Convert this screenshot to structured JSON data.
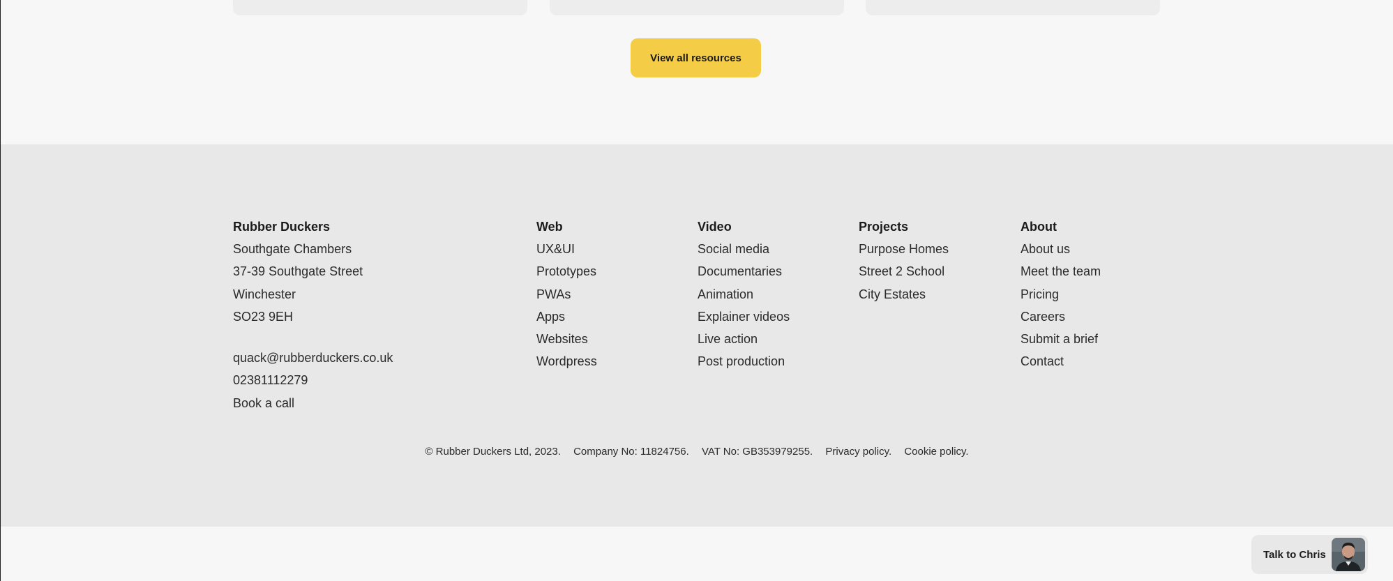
{
  "resources": {
    "view_all_label": "View all resources"
  },
  "footer": {
    "address": {
      "heading": "Rubber Duckers",
      "lines": [
        "Southgate Chambers",
        "37-39 Southgate Street",
        "Winchester",
        "SO23 9EH"
      ],
      "email": "quack@rubberduckers.co.uk",
      "phone": "02381112279",
      "book_call": "Book a call"
    },
    "columns": [
      {
        "heading": "Web",
        "items": [
          "UX&UI",
          "Prototypes",
          "PWAs",
          "Apps",
          "Websites",
          "Wordpress"
        ]
      },
      {
        "heading": "Video",
        "items": [
          "Social media",
          "Documentaries",
          "Animation",
          "Explainer videos",
          "Live action",
          "Post production"
        ]
      },
      {
        "heading": "Projects",
        "items": [
          "Purpose Homes",
          "Street 2 School",
          "City Estates"
        ]
      },
      {
        "heading": "About",
        "items": [
          "About us",
          "Meet the team",
          "Pricing",
          "Careers",
          "Submit a brief",
          "Contact"
        ]
      }
    ],
    "legal": {
      "copyright": "© Rubber Duckers Ltd, 2023.",
      "company_no": "Company No: 11824756.",
      "vat_no": "VAT No: GB353979255.",
      "privacy": "Privacy policy.",
      "cookie": "Cookie policy."
    }
  },
  "chat_widget": {
    "label": "Talk to Chris",
    "avatar_icon": "person-avatar-icon"
  },
  "colors": {
    "accent_button": "#f4cc45",
    "footer_bg": "#e8e8e9",
    "page_bg": "#f7f7f7"
  }
}
